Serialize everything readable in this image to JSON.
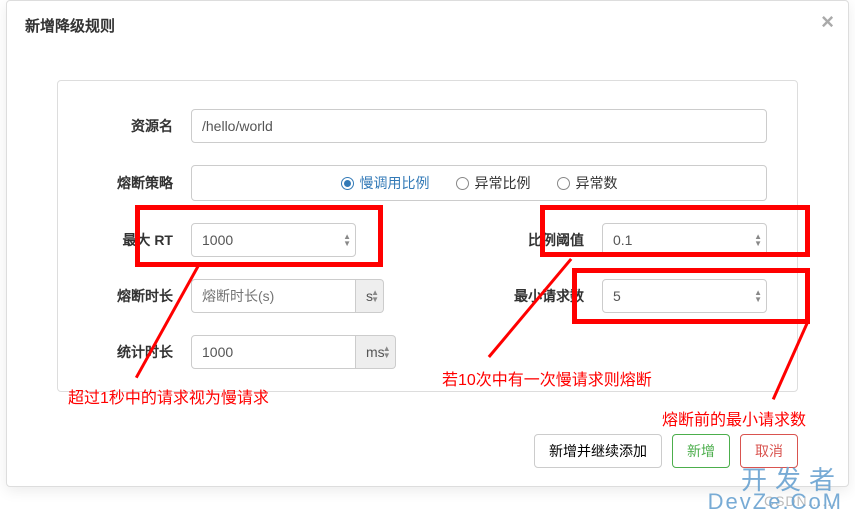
{
  "modal": {
    "title": "新增降级规则"
  },
  "form": {
    "resource": {
      "label": "资源名",
      "value": "/hello/world"
    },
    "strategy": {
      "label": "熔断策略",
      "options": [
        "慢调用比例",
        "异常比例",
        "异常数"
      ],
      "selected": 0
    },
    "maxRt": {
      "label": "最大 RT",
      "value": "1000"
    },
    "ratio": {
      "label": "比例阈值",
      "value": "0.1"
    },
    "breakDuration": {
      "label": "熔断时长",
      "placeholder": "熔断时长(s)",
      "unit": "s"
    },
    "minRequests": {
      "label": "最小请求数",
      "value": "5"
    },
    "statDuration": {
      "label": "统计时长",
      "value": "1000",
      "unit": "ms"
    }
  },
  "footer": {
    "addContinue": "新增并继续添加",
    "add": "新增",
    "cancel": "取消"
  },
  "annotations": {
    "a1": "超过1秒中的请求视为慢请求",
    "a2": "若10次中有一次慢请求则熔断",
    "a3": "熔断前的最小请求数"
  },
  "watermarks": {
    "csdn": "CSDN......",
    "dev1": "开发者",
    "dev2": "DevZe.CoM"
  }
}
